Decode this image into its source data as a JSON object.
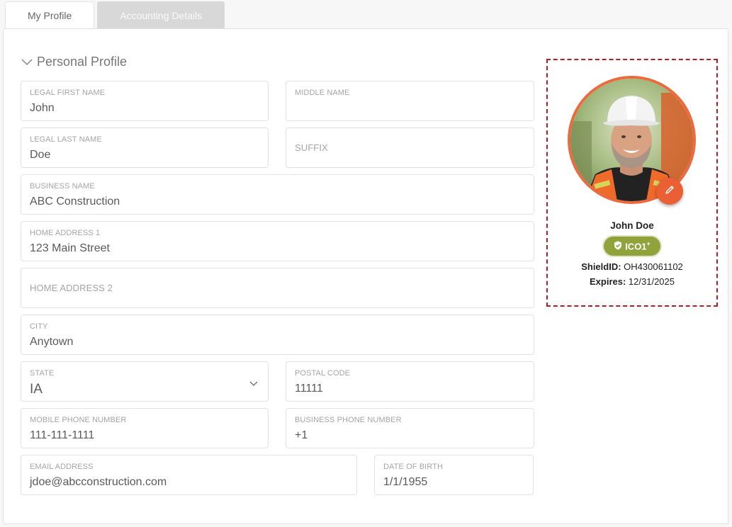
{
  "tabs": [
    {
      "label": "My Profile",
      "active": true
    },
    {
      "label": "Accounting Details",
      "active": false
    }
  ],
  "section": {
    "title": "Personal Profile"
  },
  "fields": {
    "legal_first_name": {
      "label": "LEGAL FIRST NAME",
      "value": "John"
    },
    "middle_name": {
      "label": "MIDDLE NAME",
      "value": ""
    },
    "legal_last_name": {
      "label": "LEGAL LAST NAME",
      "value": "Doe"
    },
    "suffix": {
      "label": "SUFFIX",
      "value": ""
    },
    "business_name": {
      "label": "BUSINESS NAME",
      "value": "ABC Construction"
    },
    "home_address_1": {
      "label": "HOME ADDRESS 1",
      "value": "123 Main Street"
    },
    "home_address_2": {
      "label": "HOME ADDRESS 2",
      "value": ""
    },
    "city": {
      "label": "CITY",
      "value": "Anytown"
    },
    "state": {
      "label": "STATE",
      "value": "IA"
    },
    "postal_code": {
      "label": "POSTAL CODE",
      "value": "11111"
    },
    "mobile_phone": {
      "label": "MOBILE PHONE NUMBER",
      "value": "111-111-1111"
    },
    "business_phone": {
      "label": "BUSINESS PHONE NUMBER",
      "value": "+1"
    },
    "email": {
      "label": "EMAIL ADDRESS",
      "value": "jdoe@abcconstruction.com"
    },
    "date_of_birth": {
      "label": "DATE OF BIRTH",
      "value": "1/1/1955"
    }
  },
  "profile_card": {
    "name": "John Doe",
    "badge": {
      "text": "ICO1",
      "superscript": "+"
    },
    "shield_id_label": "ShieldID:",
    "shield_id": "OH430061102",
    "expires_label": "Expires:",
    "expires": "12/31/2025"
  },
  "colors": {
    "accent": "#ec6a3d",
    "badge": "#8fa23c",
    "card_border": "#b21e24"
  },
  "icons": [
    "chevron-down-icon",
    "pencil-icon",
    "shield-check-icon"
  ]
}
